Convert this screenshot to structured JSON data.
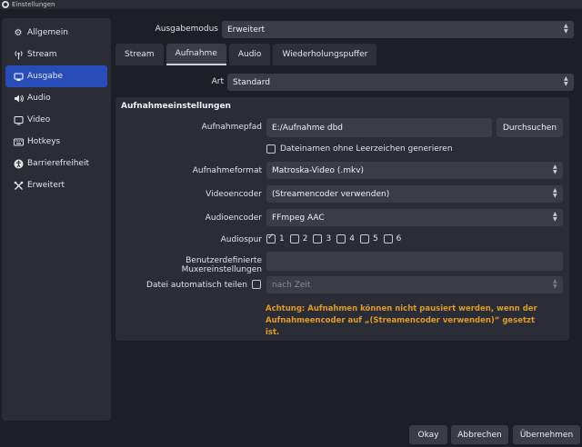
{
  "window": {
    "title": "Einstellungen"
  },
  "sidebar": {
    "items": [
      {
        "label": "Allgemein",
        "icon": "gear-icon"
      },
      {
        "label": "Stream",
        "icon": "antenna-icon"
      },
      {
        "label": "Ausgabe",
        "icon": "output-icon",
        "active": true
      },
      {
        "label": "Audio",
        "icon": "speaker-icon"
      },
      {
        "label": "Video",
        "icon": "monitor-icon"
      },
      {
        "label": "Hotkeys",
        "icon": "keyboard-icon"
      },
      {
        "label": "Barrierefreiheit",
        "icon": "accessibility-icon"
      },
      {
        "label": "Erweitert",
        "icon": "tools-icon"
      }
    ]
  },
  "output_mode": {
    "label": "Ausgabemodus",
    "value": "Erweitert"
  },
  "tabs": [
    {
      "label": "Stream"
    },
    {
      "label": "Aufnahme",
      "active": true
    },
    {
      "label": "Audio"
    },
    {
      "label": "Wiederholungspuffer"
    }
  ],
  "type": {
    "label": "Art",
    "value": "Standard"
  },
  "recording": {
    "group_title": "Aufnahmeeinstellungen",
    "path_label": "Aufnahmepfad",
    "path_value": "E:/Aufnahme dbd",
    "browse_label": "Durchsuchen",
    "no_spaces_label": "Dateinamen ohne Leerzeichen generieren",
    "format_label": "Aufnahmeformat",
    "format_value": "Matroska-Video (.mkv)",
    "video_encoder_label": "Videoencoder",
    "video_encoder_value": "(Streamencoder verwenden)",
    "audio_encoder_label": "Audioencoder",
    "audio_encoder_value": "FFmpeg AAC",
    "audio_track_label": "Audiospur",
    "tracks": [
      {
        "label": "1",
        "checked": true
      },
      {
        "label": "2",
        "checked": false
      },
      {
        "label": "3",
        "checked": false
      },
      {
        "label": "4",
        "checked": false
      },
      {
        "label": "5",
        "checked": false
      },
      {
        "label": "6",
        "checked": false
      }
    ],
    "muxer_label": "Benutzerdefinierte Muxereinstellungen",
    "muxer_value": "",
    "split_label": "Datei automatisch teilen",
    "split_value": "nach Zeit",
    "warning": "Achtung: Aufnahmen können nicht pausiert werden, wenn der Aufnahmeencoder auf „(Streamencoder verwenden)“ gesetzt ist."
  },
  "footer": {
    "okay": "Okay",
    "cancel": "Abbrechen",
    "apply": "Übernehmen"
  },
  "colors": {
    "accent": "#284cb8",
    "warning": "#e19a28",
    "background": "#1d1f26",
    "panel": "#2a2d35",
    "control": "#3a3d46"
  }
}
